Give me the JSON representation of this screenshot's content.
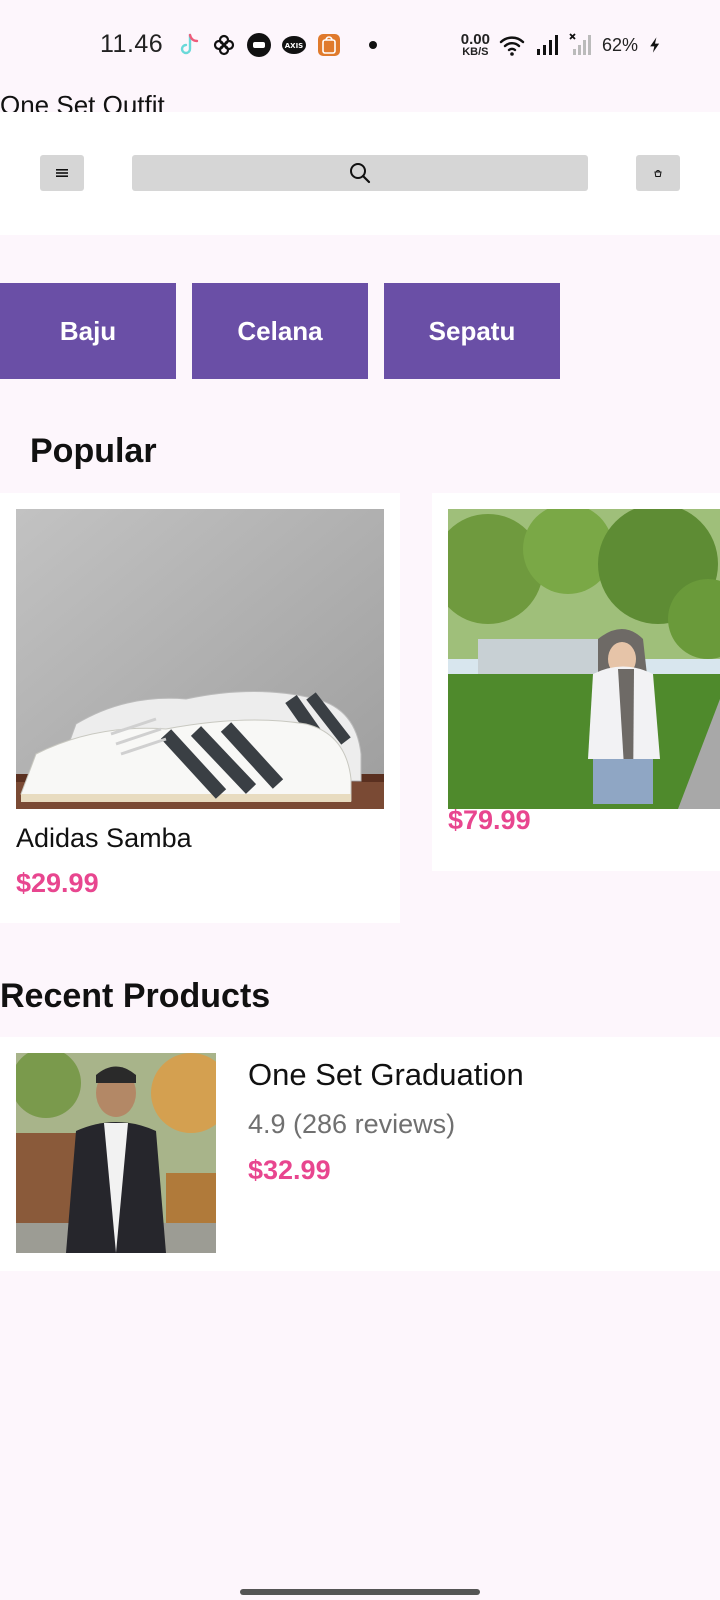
{
  "status_bar": {
    "time": "11.46",
    "net_speed_value": "0.00",
    "net_speed_unit": "KB/S",
    "battery": "62%",
    "icons": [
      "tiktok-icon",
      "pinwheel-icon",
      "app-icon",
      "axis-icon",
      "shopee-icon",
      "wifi-icon",
      "signal-icon",
      "signal-off-icon",
      "charging-icon"
    ]
  },
  "app": {
    "title": "One Set Outfit"
  },
  "toolbar": {
    "menu_icon": "menu-icon",
    "search_icon": "search-icon",
    "cart_icon": "cart-icon"
  },
  "categories": [
    "Baju",
    "Celana",
    "Sepatu"
  ],
  "popular": {
    "title": "Popular",
    "items": [
      {
        "name": "Adidas Samba",
        "price": "$29.99",
        "image": "white sneakers with black stripes"
      },
      {
        "name": "",
        "price": "$79.99",
        "image": "woman in hijab standing in park"
      }
    ]
  },
  "recent": {
    "title": "Recent Products",
    "items": [
      {
        "name": "One Set Graduation",
        "rating": "4.9 (286 reviews)",
        "price": "$32.99",
        "image": "young man in black blazer"
      }
    ]
  },
  "colors": {
    "background": "#fdf6fc",
    "category": "#6a4fa6",
    "price": "#e8468f",
    "toolbar_button": "#d6d6d6"
  }
}
